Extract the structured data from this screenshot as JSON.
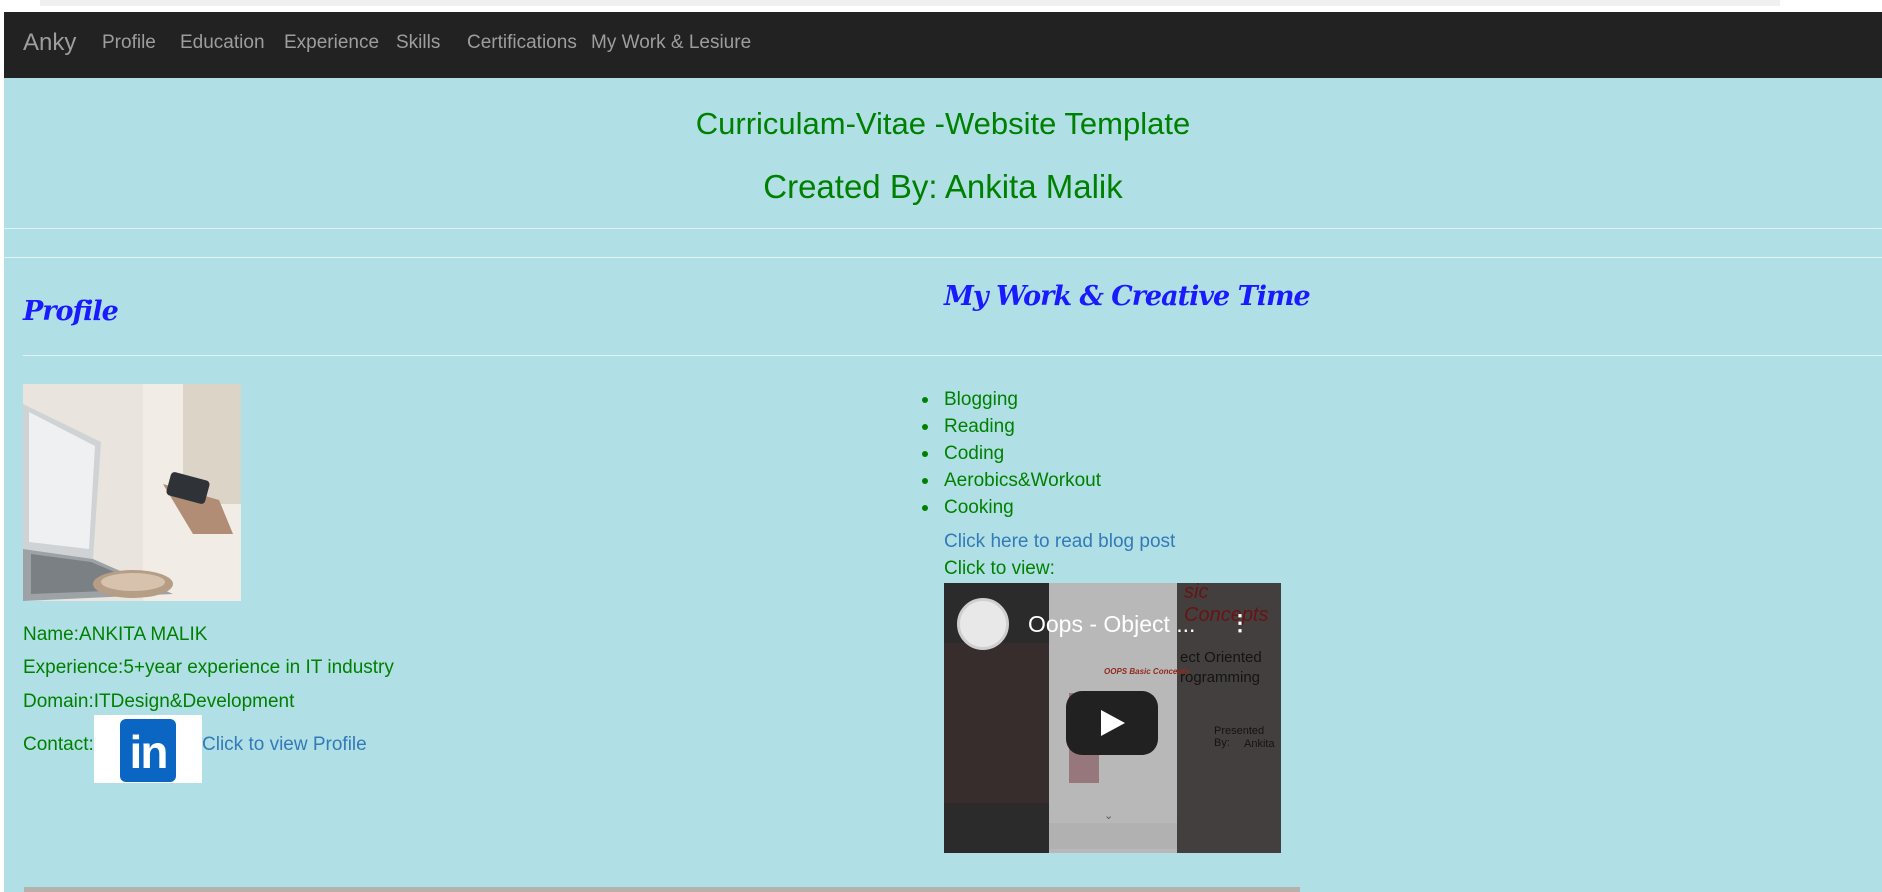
{
  "nav": {
    "brand": "Anky",
    "items": [
      "Profile",
      "Education",
      "Experience",
      "Skills",
      "Certifications",
      "My Work & Lesiure"
    ]
  },
  "header": {
    "title": "Curriculam-Vitae -Website Template",
    "subtitle": "Created By: Ankita Malik"
  },
  "profile": {
    "heading": "Profile",
    "photo_icon": "laptop-photo",
    "name": "Name:ANKITA MALIK",
    "experience": "Experience:5+year experience in IT industry",
    "domain": "Domain:ITDesign&Development",
    "contact_label": "Contact:",
    "linkedin_icon": "in",
    "profile_link": "Click to view Profile"
  },
  "work": {
    "heading": "My Work & Creative Time",
    "hobbies": [
      "Blogging",
      "Reading",
      "Coding",
      "Aerobics&Workout",
      "Cooking"
    ],
    "blog_link": "Click here to read blog post",
    "view_label": "Click to view:",
    "video": {
      "title": "Oops - Object ...",
      "slide_title": "sic Concepts",
      "slide_heading": "OOPS Basic Concepts",
      "slide_line1": "ect Oriented",
      "slide_line2": "rogramming",
      "slide_presented": "Presented By:",
      "slide_author": "Ankita"
    }
  },
  "colors": {
    "navbar": "#222222",
    "background": "#b0e0e6",
    "text_green": "#008000",
    "link_blue": "#337ab7",
    "heading_blue": "#1a1aff",
    "linkedin_blue": "#0a66c2"
  }
}
